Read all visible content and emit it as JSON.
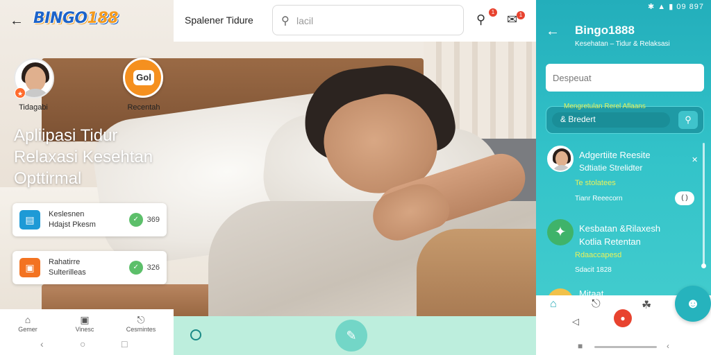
{
  "left_app": {
    "logo_text": "BINGO",
    "logo_number": "188",
    "profile_label": "Tidagabi",
    "brand_icon_text": "Gol",
    "brand_label": "Recentah",
    "hero_lines": [
      "Apliipasi Tidur",
      "Relaxasi Kesehtan",
      "Opttirmal"
    ],
    "cards": [
      {
        "line1": "Keslesnen",
        "line2": "Hdajst Pkesm",
        "pill": "369"
      },
      {
        "line1": "Rahatirre",
        "line2": "Sulterilleas",
        "pill": "326"
      }
    ],
    "bottom_nav": [
      "Gemer",
      "Vinesc",
      "Cesmintes"
    ]
  },
  "center": {
    "app_title": "Spalener Tidure",
    "search_placeholder": "lacil",
    "notif_counts": [
      "1",
      "1"
    ]
  },
  "right_app": {
    "status_time": "09 897",
    "title": "Bingo1888",
    "subtitle": "Kesehatan – Tidur & Relaksasi",
    "input_placeholder": "Despeuat",
    "field_label": "Mengretulan Rerel Aflaans",
    "search_text": "& Bredert",
    "items": [
      {
        "line1": "Adgertiite Reesite",
        "line2": "Sdtiatie Strelidter",
        "line3": "Te stolatees",
        "line4": "Tianr Reeecorn"
      },
      {
        "line1": "Kesbatan &Rilaxesh",
        "line2": "Kotlia Retentan",
        "line3": "Rdaaccapesd",
        "line4": "Sdacit 1828"
      },
      {
        "line1": "Mitaat"
      }
    ]
  },
  "colors": {
    "teal_panel": "#33c3c9",
    "orange_brand": "#f5901f",
    "logo_blue": "#1d63c9",
    "mint_bar": "#bdeedd"
  },
  "icons": [
    "back-arrow-icon",
    "search-icon",
    "bell-icon",
    "chat-icon",
    "home-icon",
    "twitter-icon"
  ]
}
